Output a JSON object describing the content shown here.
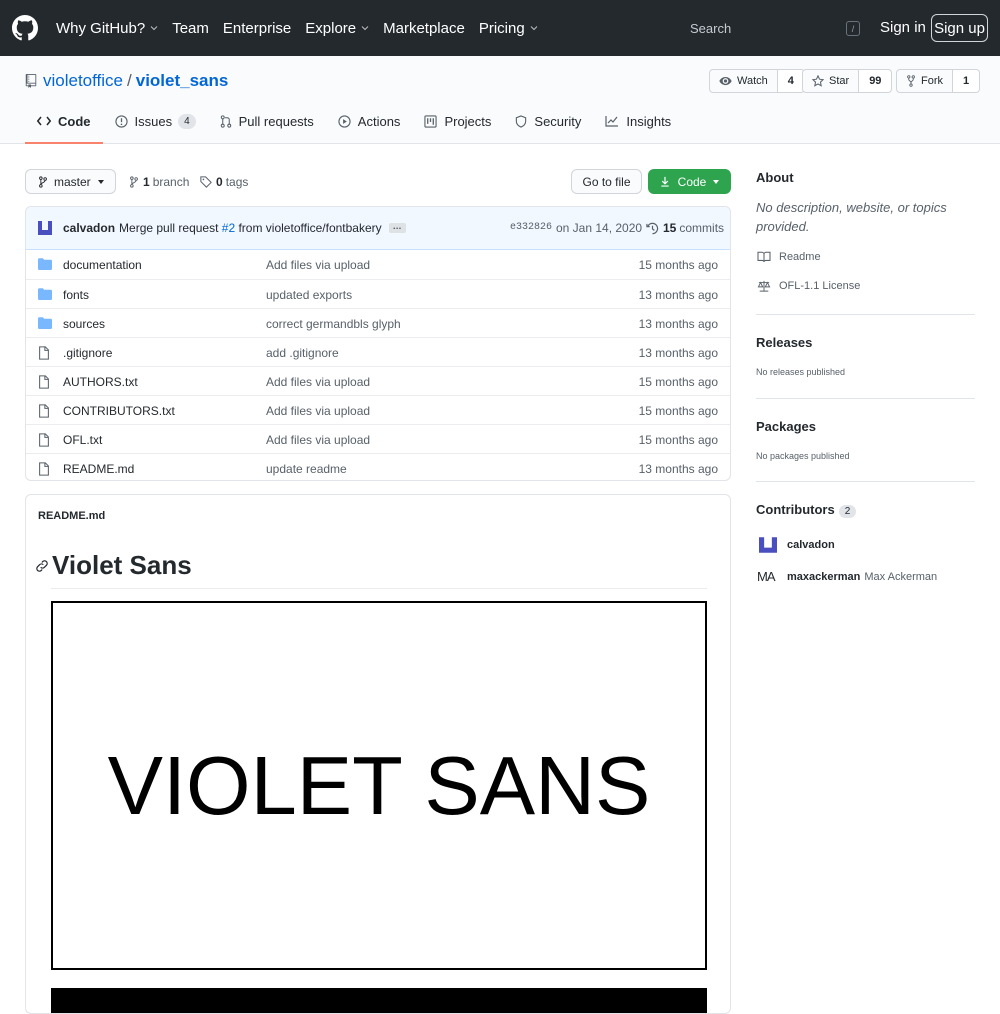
{
  "header": {
    "nav": [
      "Why GitHub?",
      "Team",
      "Enterprise",
      "Explore",
      "Marketplace",
      "Pricing"
    ],
    "search_placeholder": "Search",
    "search_key": "/",
    "signin": "Sign in",
    "signup": "Sign up"
  },
  "repo": {
    "owner": "violetoffice",
    "separator": "/",
    "name": "violet_sans",
    "watch_label": "Watch",
    "watch_count": "4",
    "star_label": "Star",
    "star_count": "99",
    "fork_label": "Fork",
    "fork_count": "1"
  },
  "tabs": [
    {
      "label": "Code"
    },
    {
      "label": "Issues",
      "badge": "4"
    },
    {
      "label": "Pull requests"
    },
    {
      "label": "Actions"
    },
    {
      "label": "Projects"
    },
    {
      "label": "Security"
    },
    {
      "label": "Insights"
    }
  ],
  "toolbar": {
    "branch": "master",
    "branch_count": "1",
    "branch_word": "branch",
    "tag_count": "0",
    "tag_word": "tags",
    "goto_file": "Go to file",
    "code": "Code"
  },
  "commit": {
    "author": "calvadon",
    "msg_pre": "Merge pull request",
    "pr": "#2",
    "msg_post": "from violetoffice/fontbakery",
    "ellipsis": "…",
    "sha": "e332826",
    "date": "on Jan 14, 2020",
    "count": "15",
    "count_word": "commits"
  },
  "files": [
    {
      "type": "dir",
      "name": "documentation",
      "message": "Add files via upload",
      "age": "15 months ago"
    },
    {
      "type": "dir",
      "name": "fonts",
      "message": "updated exports",
      "age": "13 months ago"
    },
    {
      "type": "dir",
      "name": "sources",
      "message": "correct germandbls glyph",
      "age": "13 months ago"
    },
    {
      "type": "file",
      "name": ".gitignore",
      "message": "add .gitignore",
      "age": "13 months ago"
    },
    {
      "type": "file",
      "name": "AUTHORS.txt",
      "message": "Add files via upload",
      "age": "15 months ago"
    },
    {
      "type": "file",
      "name": "CONTRIBUTORS.txt",
      "message": "Add files via upload",
      "age": "15 months ago"
    },
    {
      "type": "file",
      "name": "OFL.txt",
      "message": "Add files via upload",
      "age": "15 months ago"
    },
    {
      "type": "file",
      "name": "README.md",
      "message": "update readme",
      "age": "13 months ago"
    }
  ],
  "readme": {
    "filename": "README.md",
    "heading": "Violet Sans",
    "banner_text": "VIOLET SANS"
  },
  "sidebar": {
    "about_title": "About",
    "about_desc": "No description, website, or topics provided.",
    "readme_link": "Readme",
    "license_link": "OFL-1.1 License",
    "releases_title": "Releases",
    "releases_note": "No releases published",
    "packages_title": "Packages",
    "packages_note": "No packages published",
    "contributors_title": "Contributors",
    "contributors_count": "2",
    "contributors": [
      {
        "login": "calvadon",
        "full": ""
      },
      {
        "login": "maxackerman",
        "full": "Max Ackerman",
        "logo": "MA"
      }
    ]
  },
  "colors": {
    "header_bg": "#24292e",
    "link": "#0366d6",
    "green_button": "#2ea44f",
    "tab_underline": "#f9826c",
    "folder": "#79b8ff",
    "avatar": "#4a4fbf"
  }
}
